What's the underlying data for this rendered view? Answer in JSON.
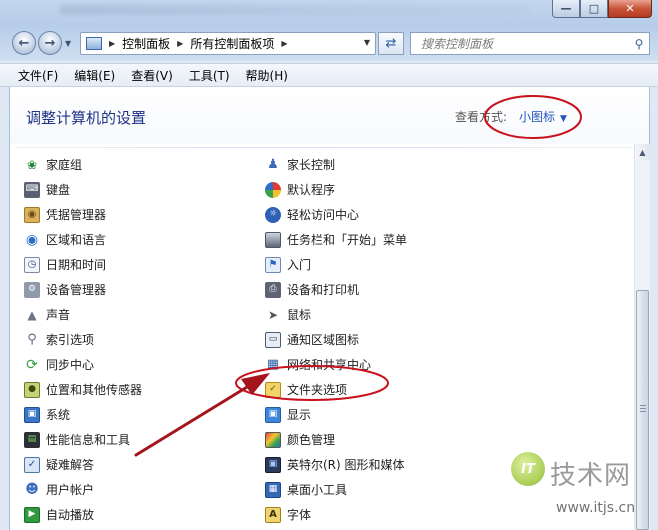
{
  "address_bar": {
    "crumbs": [
      "控制面板",
      "所有控制面板项"
    ],
    "search_placeholder": "搜索控制面板"
  },
  "menu": [
    "文件(F)",
    "编辑(E)",
    "查看(V)",
    "工具(T)",
    "帮助(H)"
  ],
  "header": {
    "title": "调整计算机的设置",
    "view_by_label": "查看方式:",
    "view_by_value": "小图标"
  },
  "items_left": [
    {
      "label": "家庭组",
      "icon": "homegroup-icon"
    },
    {
      "label": "键盘",
      "icon": "keyboard-icon"
    },
    {
      "label": "凭据管理器",
      "icon": "credential-manager-icon"
    },
    {
      "label": "区域和语言",
      "icon": "region-language-icon"
    },
    {
      "label": "日期和时间",
      "icon": "date-time-icon"
    },
    {
      "label": "设备管理器",
      "icon": "device-manager-icon"
    },
    {
      "label": "声音",
      "icon": "sound-icon"
    },
    {
      "label": "索引选项",
      "icon": "indexing-options-icon"
    },
    {
      "label": "同步中心",
      "icon": "sync-center-icon"
    },
    {
      "label": "位置和其他传感器",
      "icon": "location-sensors-icon"
    },
    {
      "label": "系统",
      "icon": "system-icon"
    },
    {
      "label": "性能信息和工具",
      "icon": "performance-icon"
    },
    {
      "label": "疑难解答",
      "icon": "troubleshooting-icon"
    },
    {
      "label": "用户帐户",
      "icon": "user-accounts-icon"
    },
    {
      "label": "自动播放",
      "icon": "autoplay-icon"
    }
  ],
  "items_right": [
    {
      "label": "家长控制",
      "icon": "parental-controls-icon"
    },
    {
      "label": "默认程序",
      "icon": "default-programs-icon"
    },
    {
      "label": "轻松访问中心",
      "icon": "ease-of-access-icon"
    },
    {
      "label": "任务栏和「开始」菜单",
      "icon": "taskbar-start-menu-icon"
    },
    {
      "label": "入门",
      "icon": "getting-started-icon"
    },
    {
      "label": "设备和打印机",
      "icon": "devices-printers-icon"
    },
    {
      "label": "鼠标",
      "icon": "mouse-icon"
    },
    {
      "label": "通知区域图标",
      "icon": "notification-area-icon"
    },
    {
      "label": "网络和共享中心",
      "icon": "network-sharing-icon"
    },
    {
      "label": "文件夹选项",
      "icon": "folder-options-icon"
    },
    {
      "label": "显示",
      "icon": "display-icon"
    },
    {
      "label": "颜色管理",
      "icon": "color-management-icon"
    },
    {
      "label": "英特尔(R) 图形和媒体",
      "icon": "intel-graphics-icon"
    },
    {
      "label": "桌面小工具",
      "icon": "desktop-gadgets-icon"
    },
    {
      "label": "字体",
      "icon": "fonts-icon"
    }
  ],
  "watermark": {
    "badge": "IT",
    "title": "技术网",
    "url": "www.itjs.cn"
  },
  "colors": {
    "title_blue": "#1e3287",
    "link_blue": "#1e55bd",
    "annotation_red": "#c8121e"
  }
}
